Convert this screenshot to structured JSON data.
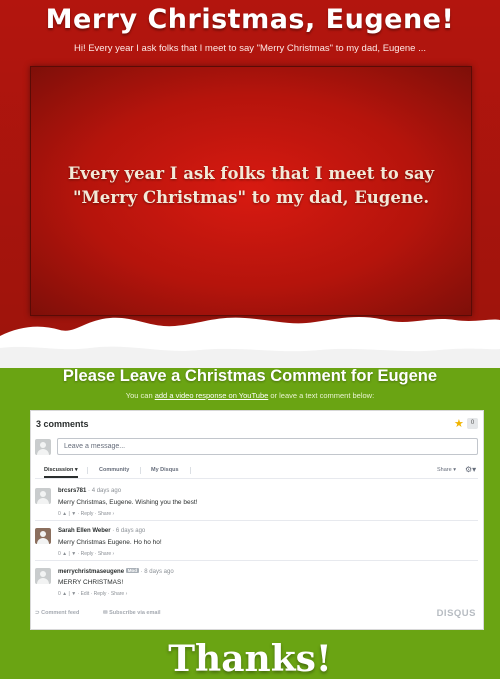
{
  "page": {
    "title": "Merry Christmas, Eugene!",
    "subtitle": "Hi!  Every year I ask folks that I meet to say \"Merry Christmas\" to my dad, Eugene ...",
    "video_text_line1": "Every year I ask folks that I meet to say",
    "video_text_line2": "\"Merry Christmas\" to my dad, Eugene.",
    "colors": {
      "red": "#b3150e",
      "green": "#6aa413",
      "snow": "#ffffff"
    }
  },
  "comments_section": {
    "heading": "Please Leave a Christmas Comment for Eugene",
    "sub_before": "You can ",
    "sub_link": "add a video response on YouTube",
    "sub_after": " or leave a text comment below:"
  },
  "disqus": {
    "count_label": "3 comments",
    "star_count": "0",
    "input_placeholder": "Leave a message...",
    "tabs": {
      "discussion": "Discussion",
      "community": "Community",
      "my_disqus": "My Disqus"
    },
    "share_label": "Share",
    "comments": [
      {
        "author": "brcsrs781",
        "time": "· 4 days ago",
        "message": "Merry Christmas, Eugene. Wishing you the best!",
        "actions": "0 ▲ | ▼ · Reply · Share ›"
      },
      {
        "author": "Sarah Ellen Weber",
        "time": "· 6 days ago",
        "message": "Merry Christmas Eugene. Ho ho ho!",
        "actions": "0 ▲ | ▼ · Reply · Share ›"
      },
      {
        "author": "merrychristmaseugene",
        "badge": "Mod",
        "time": "· 8 days ago",
        "message": "MERRY CHRISTMAS!",
        "actions": "0 ▲ | ▼ · Edit · Reply · Share ›"
      }
    ],
    "footer": {
      "comment_feed": "Comment feed",
      "subscribe": "Subscribe via email",
      "logo": "DISQUS"
    }
  },
  "thanks": "Thanks!"
}
